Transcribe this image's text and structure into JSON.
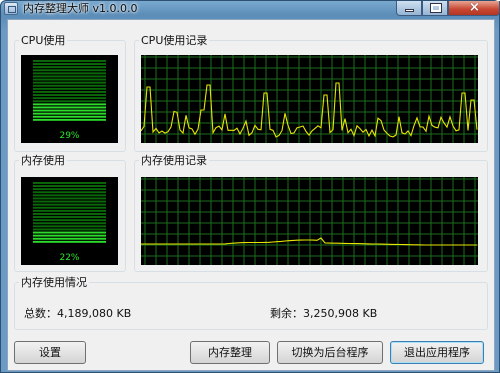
{
  "window": {
    "title": "内存整理大师 v1.0.0.0",
    "close_glyph": "×"
  },
  "cpu_usage": {
    "label": "CPU使用",
    "percent": 29,
    "percent_text": "29%"
  },
  "cpu_history": {
    "label": "CPU使用记录",
    "line_color": "#e6e600"
  },
  "mem_usage": {
    "label": "内存使用",
    "percent": 22,
    "percent_text": "22%"
  },
  "mem_history": {
    "label": "内存使用记录",
    "line_color": "#e6e600"
  },
  "mem_info": {
    "label": "内存使用情况",
    "total": "总数：4,189,080 KB",
    "free": "剩余：3,250,908 KB"
  },
  "buttons": {
    "settings": "设置",
    "optimize": "内存整理",
    "background": "切换为后台程序",
    "exit": "退出应用程序"
  },
  "colors": {
    "meter_lit": "#2bdc2b",
    "meter_dim": "#0a6a0a",
    "grid": "#1e6e1e",
    "graph_bg": "#000000"
  }
}
